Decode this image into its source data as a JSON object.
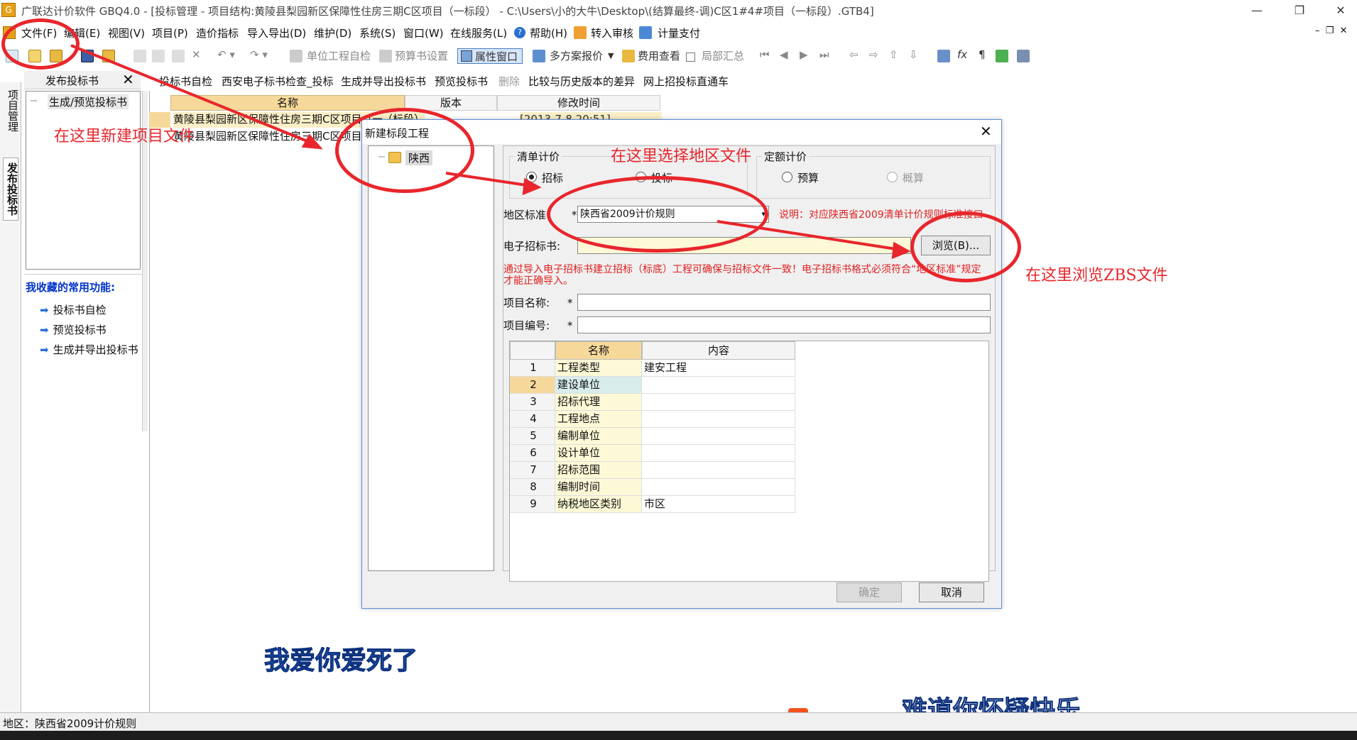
{
  "window": {
    "title": "广联达计价软件 GBQ4.0 - [投标管理 - 项目结构:黄陵县梨园新区保障性住房三期C区项目（一标段） - C:\\Users\\小的大牛\\Desktop\\(结算最终-调)C区1#4#项目（一标段）.GTB4]",
    "min": "—",
    "max": "❐",
    "close": "✕"
  },
  "menu": [
    "文件(F)",
    "编辑(E)",
    "视图(V)",
    "项目(P)",
    "造价指标",
    "导入导出(D)",
    "维护(D)",
    "系统(S)",
    "窗口(W)",
    "在线服务(L)",
    "帮助(H)",
    "转入审核",
    "计量支付"
  ],
  "toolbar": {
    "unit_check": "单位工程自检",
    "budget_settings": "预算书设置",
    "properties": "属性窗口",
    "multi_quote": "多方案报价",
    "fee_view": "费用查看",
    "partial_total": "局部汇总"
  },
  "toolbar2": [
    "投标书自检",
    "西安电子标书检查_投标",
    "生成并导出投标书",
    "预览投标书",
    "删除",
    "比较与历史版本的差异",
    "网上招投标直通车"
  ],
  "left": {
    "vtab_project": "项目管理",
    "vtab_publish": "发布投标书",
    "panel_title": "发布投标书",
    "tree_item": "生成/预览投标书",
    "fav_title": "我收藏的常用功能:",
    "fav_items": [
      "投标书自检",
      "预览投标书",
      "生成并导出投标书"
    ]
  },
  "grid": {
    "headers": [
      "名称",
      "版本",
      "修改时间"
    ],
    "rows": [
      {
        "name": "黄陵县梨园新区保障性住房三期C区项目（一标段）",
        "extra": "（标段）黄",
        "time": "[2013-7-8  20:51]"
      },
      {
        "name": "黄陵县梨园新区保障性住房三期C区项目",
        "extra": "",
        "time": ""
      }
    ]
  },
  "dialog": {
    "title": "新建标段工程",
    "tree_region": "陕西",
    "group_qd": "清单计价",
    "radio_zb": "招标",
    "radio_tb": "投标",
    "group_de": "定额计价",
    "radio_ys": "预算",
    "radio_gs": "概算",
    "label_region": "地区标准：",
    "required": "*",
    "region_value": "陕西省2009计价规则",
    "region_note": "说明：对应陕西省2009清单计价规则标准接口",
    "label_ebid": "电子招标书:",
    "browse": "浏览(B)...",
    "warning": "通过导入电子招标书建立招标（标底）工程可确保与招标文件一致！电子招标书格式必须符合“地区标准”规定才能正确导入。",
    "label_name": "项目名称:",
    "label_code": "项目编号:",
    "table_headers": [
      "名称",
      "内容"
    ],
    "table_rows": [
      {
        "no": "1",
        "name": "工程类型",
        "value": "建安工程"
      },
      {
        "no": "2",
        "name": "建设单位",
        "value": ""
      },
      {
        "no": "3",
        "name": "招标代理",
        "value": ""
      },
      {
        "no": "4",
        "name": "工程地点",
        "value": ""
      },
      {
        "no": "5",
        "name": "编制单位",
        "value": ""
      },
      {
        "no": "6",
        "name": "设计单位",
        "value": ""
      },
      {
        "no": "7",
        "name": "招标范围",
        "value": ""
      },
      {
        "no": "8",
        "name": "编制时间",
        "value": ""
      },
      {
        "no": "9",
        "name": "纳税地区类别",
        "value": "市区"
      }
    ],
    "ok": "确定",
    "cancel": "取消"
  },
  "annotations": {
    "new_project": "在这里新建项目文件",
    "choose_region": "在这里选择地区文件",
    "browse_zbs": "在这里浏览ZBS文件"
  },
  "subtitles": {
    "line1": "我爱你爱死了",
    "line2": "难道你怀疑快乐"
  },
  "status": {
    "region": "地区：陕西省2009计价规则"
  },
  "colors": {
    "annotation_red": "#e8262c",
    "subtitle_blue": "#2b6cd8",
    "grid_header": "#f6d99a",
    "dialog_border": "#5b8fd6"
  }
}
